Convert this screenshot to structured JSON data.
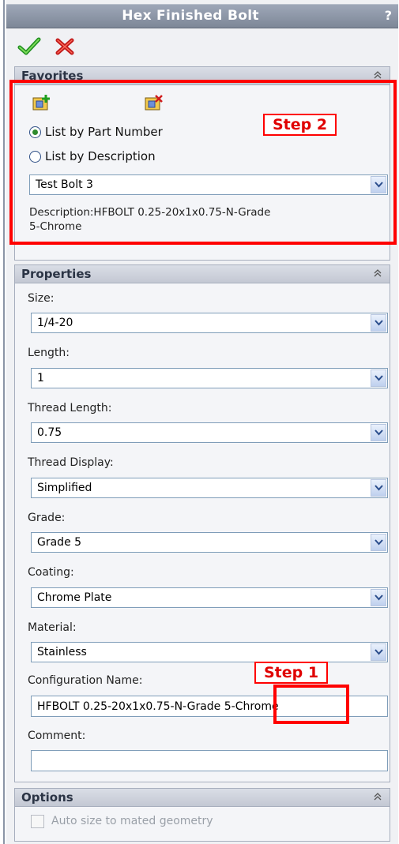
{
  "window": {
    "title": "Hex Finished Bolt",
    "help": "?"
  },
  "actions": {
    "ok_icon": "green-check-icon",
    "cancel_icon": "red-x-icon"
  },
  "favorites": {
    "title": "Favorites",
    "add_icon": "add-favorite-icon",
    "delete_icon": "delete-favorite-icon",
    "radio_part_number": "List by Part Number",
    "radio_description": "List by Description",
    "selected_radio": "List by Part Number",
    "favorite_value": "Test Bolt 3",
    "description_line1": "Description:HFBOLT 0.25-20x1x0.75-N-Grade",
    "description_line2": "5-Chrome"
  },
  "properties": {
    "title": "Properties",
    "size_label": "Size:",
    "size_value": "1/4-20",
    "length_label": "Length:",
    "length_value": "1",
    "thread_length_label": "Thread Length:",
    "thread_length_value": "0.75",
    "thread_display_label": "Thread Display:",
    "thread_display_value": "Simplified",
    "grade_label": "Grade:",
    "grade_value": "Grade 5",
    "coating_label": "Coating:",
    "coating_value": "Chrome Plate",
    "material_label": "Material:",
    "material_value": "Stainless",
    "config_label": "Configuration Name:",
    "config_value": "HFBOLT 0.25-20x1x0.75-N-Grade 5-Chrome",
    "comment_label": "Comment:",
    "comment_value": ""
  },
  "options": {
    "title": "Options",
    "auto_size_label": "Auto size to mated geometry",
    "auto_size_checked": false
  },
  "annotations": {
    "step1": "Step 1",
    "step2": "Step 2",
    "highlight_color": "#ff0000"
  }
}
